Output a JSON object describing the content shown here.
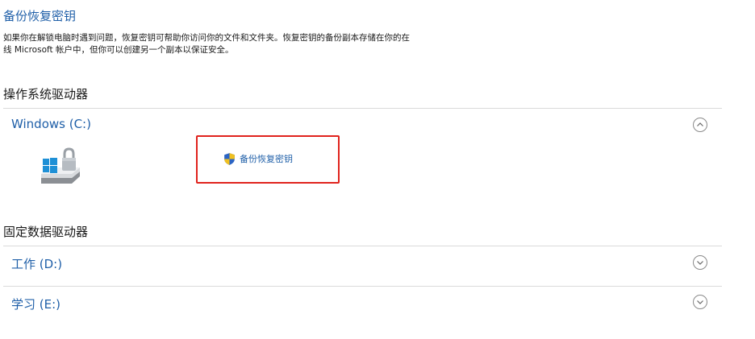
{
  "header": {
    "title": "备份恢复密钥",
    "description_line1": "如果你在解锁电脑时遇到问题，恢复密钥可帮助你访问你的文件和文件夹。恢复密钥的备份副本存储在你的在",
    "description_line2": "线 Microsoft 帐户中，但你可以创建另一个副本以保证安全。"
  },
  "os_section": {
    "title": "操作系统驱动器",
    "drives": [
      {
        "name": "Windows (C:)",
        "expanded": true,
        "action_label": "备份恢复密钥"
      }
    ]
  },
  "data_section": {
    "title": "固定数据驱动器",
    "drives": [
      {
        "name": "工作 (D:)",
        "expanded": false
      },
      {
        "name": "学习 (E:)",
        "expanded": false
      }
    ]
  },
  "colors": {
    "link": "#1f5fa8",
    "highlight": "#e0231d",
    "divider": "#dadada"
  },
  "icons": [
    "drive-lock-icon",
    "uac-shield-icon",
    "chevron-up-icon",
    "chevron-down-icon"
  ]
}
